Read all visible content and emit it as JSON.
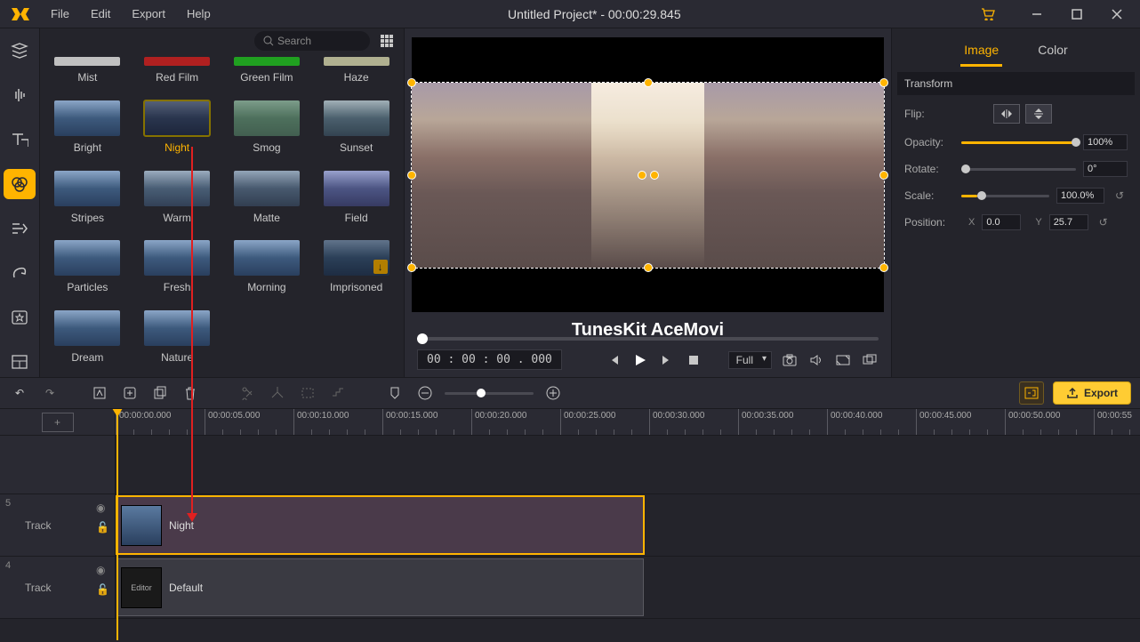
{
  "title": "Untitled Project* - 00:00:29.845",
  "menu": {
    "file": "File",
    "edit": "Edit",
    "export": "Export",
    "help": "Help"
  },
  "search": {
    "placeholder": "Search"
  },
  "filters": {
    "row0": [
      "Mist",
      "Red Film",
      "Green Film",
      "Haze"
    ],
    "row1": [
      "Bright",
      "Night",
      "Smog",
      "Sunset"
    ],
    "row2": [
      "Stripes",
      "Warm",
      "Matte",
      "Field"
    ],
    "row3": [
      "Particles",
      "Fresh",
      "Morning",
      "Imprisoned"
    ],
    "row4": [
      "Dream",
      "Nature"
    ]
  },
  "preview": {
    "watermark": "TunesKit AceMovi",
    "timecode": "00 : 00 : 00 . 000",
    "viewmode": "Full"
  },
  "inspector": {
    "tabs": {
      "image": "Image",
      "color": "Color"
    },
    "section": "Transform",
    "flip": "Flip:",
    "opacity": "Opacity:",
    "opacity_val": "100%",
    "rotate": "Rotate:",
    "rotate_val": "0°",
    "scale": "Scale:",
    "scale_val": "100.0%",
    "position": "Position:",
    "x_label": "X",
    "x_val": "0.0",
    "y_label": "Y",
    "y_val": "25.7"
  },
  "toolbar": {
    "export": "Export"
  },
  "timeline": {
    "ticks": [
      "00:00:00.000",
      "00:00:05.000",
      "00:00:10.000",
      "00:00:15.000",
      "00:00:20.000",
      "00:00:25.000",
      "00:00:30.000",
      "00:00:35.000",
      "00:00:40.000",
      "00:00:45.000",
      "00:00:50.000",
      "00:00:55"
    ],
    "track5_num": "5",
    "track5_name": "Track",
    "track4_num": "4",
    "track4_name": "Track",
    "clip_night": "Night",
    "clip_default": "Default",
    "clip_editor_thumb": "Editor"
  }
}
